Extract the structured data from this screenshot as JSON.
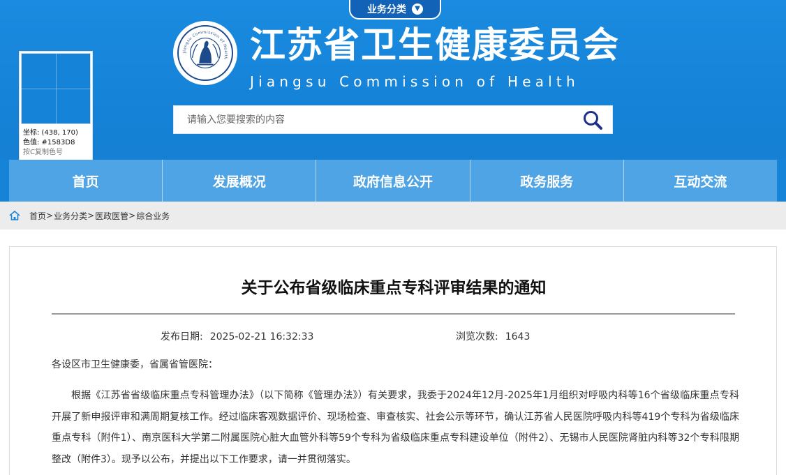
{
  "colors": {
    "brand_blue": "#1583D8",
    "nav_blue": "#4ea4e4",
    "breadcrumb_bg": "#ececec"
  },
  "header": {
    "category_tab": {
      "label": "业务分类",
      "icon": "chevron-down-icon"
    },
    "emblem": {
      "ring_text": "Jiangsu Commission of Health",
      "icon": "jiangsu-health-emblem-icon"
    },
    "title_cn": "江苏省卫生健康委员会",
    "title_en": "Jiangsu Commission of Health",
    "search": {
      "placeholder": "请输入您要搜索的内容",
      "value": "",
      "icon": "search-icon"
    }
  },
  "color_picker": {
    "coords_label": "坐标: (438, 170)",
    "color_label": "色值: #1583D8",
    "hint": "按C复制色号"
  },
  "nav": {
    "items": [
      {
        "label": "首页"
      },
      {
        "label": "发展概况"
      },
      {
        "label": "政府信息公开"
      },
      {
        "label": "政务服务"
      },
      {
        "label": "互动交流"
      }
    ]
  },
  "breadcrumb": {
    "home_icon": "home-icon",
    "items": [
      {
        "label": "首页"
      },
      {
        "label": "业务分类"
      },
      {
        "label": "医政医管"
      },
      {
        "label": "综合业务"
      }
    ],
    "separator": ">"
  },
  "article": {
    "title": "关于公布省级临床重点专科评审结果的通知",
    "publish_label": "发布日期:",
    "publish_value": "2025-02-21 16:32:33",
    "views_label": "浏览次数:",
    "views_value": "1643",
    "salutation": "各设区市卫生健康委，省属省管医院：",
    "paragraph": "根据《江苏省省级临床重点专科管理办法》（以下简称《管理办法》）有关要求，我委于2024年12月-2025年1月组织对呼吸内科等16个省级临床重点专科开展了新申报评审和满周期复核工作。经过临床客观数据评价、现场检查、审查核实、社会公示等环节，确认江苏省人民医院呼吸内科等419个专科为省级临床重点专科（附件1）、南京医科大学第二附属医院心脏大血管外科等59个专科为省级临床重点专科建设单位（附件2）、无锡市人民医院肾脏内科等32个专科限期整改（附件3）。现予以公布，并提出以下工作要求，请一并贯彻落实。"
  }
}
